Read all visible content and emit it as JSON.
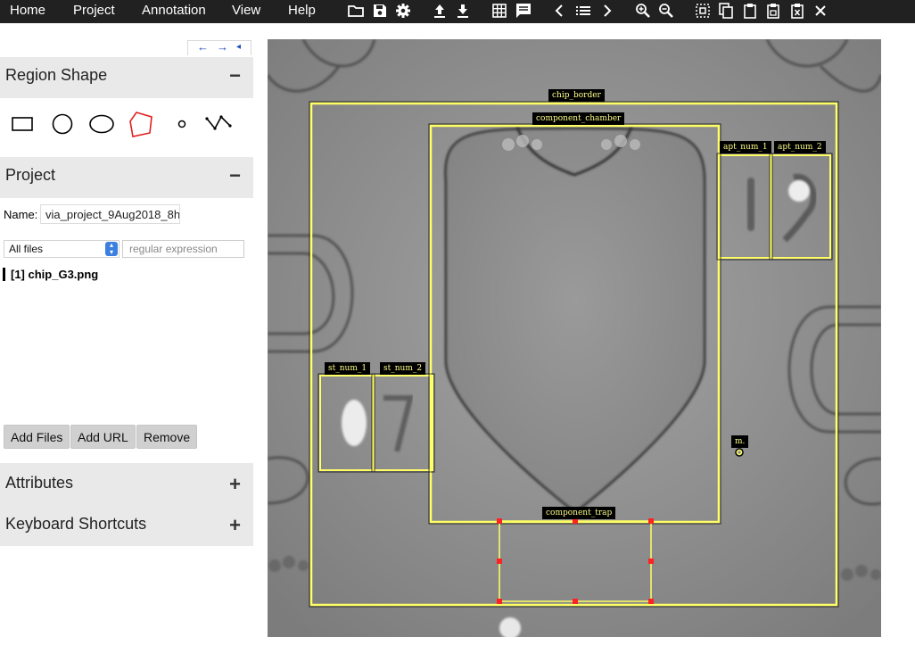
{
  "menu": {
    "home": "Home",
    "project": "Project",
    "annotation": "Annotation",
    "view": "View",
    "help": "Help"
  },
  "toolbar_icons": [
    "folder-open-icon",
    "save-icon",
    "settings-icon",
    "upload-icon",
    "download-icon",
    "grid-view-icon",
    "comment-icon",
    "prev-image-icon",
    "image-list-icon",
    "next-image-icon",
    "zoom-in-icon",
    "zoom-out-icon",
    "select-all-icon",
    "copy-icon",
    "paste-icon",
    "paste-special-icon",
    "delete-region-icon",
    "close-icon"
  ],
  "nav_arrows": {
    "left": "←",
    "right": "→",
    "collapse": "◂"
  },
  "region_shape": {
    "title": "Region Shape",
    "toggle": "−",
    "selected": "polygon"
  },
  "project": {
    "title": "Project",
    "toggle": "−",
    "name_label": "Name:",
    "name_value": "via_project_9Aug2018_8h",
    "filter_value": "All files",
    "regex_placeholder": "regular expression",
    "files": [
      "[1] chip_G3.png"
    ],
    "buttons": {
      "add_files": "Add Files",
      "add_url": "Add URL",
      "remove": "Remove"
    }
  },
  "attributes": {
    "title": "Attributes",
    "toggle": "+"
  },
  "shortcuts": {
    "title": "Keyboard Shortcuts",
    "toggle": "+"
  },
  "regions": {
    "chip_border": "chip_border",
    "component_chamber": "component_chamber",
    "apt_num_1": "apt_num_1",
    "apt_num_2": "apt_num_2",
    "st_num_1": "st_num_1",
    "st_num_2": "st_num_2",
    "component_trap": "component_trap",
    "point_label": "m."
  },
  "colors": {
    "topbar": "#212121",
    "annotation": "#ffff66",
    "selected_handle": "#ff2222",
    "section_bg": "#e9e9e9",
    "selected_shape": "#e02020"
  }
}
